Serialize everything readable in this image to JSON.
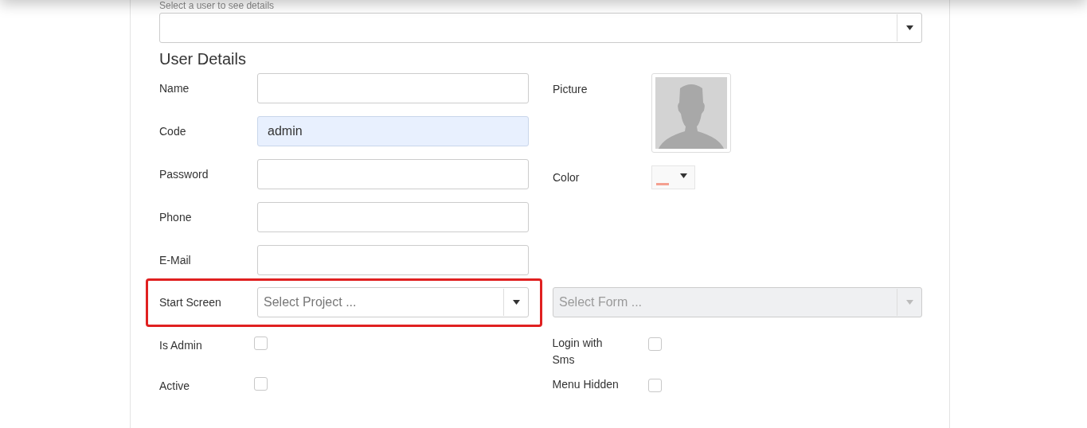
{
  "user_select": {
    "label": "Select a user to see details"
  },
  "heading": "User Details",
  "fields": [
    {
      "label": "Name",
      "autofilled": false
    },
    {
      "label": "Code",
      "value": "admin",
      "autofilled": true
    },
    {
      "label": "Password",
      "autofilled": false
    },
    {
      "label": "Phone",
      "autofilled": false
    },
    {
      "label": "E-Mail",
      "autofilled": false
    }
  ],
  "picture": {
    "label": "Picture"
  },
  "color_picker": {
    "label": "Color",
    "color": "#f4a090"
  },
  "start_screen": {
    "label": "Start Screen",
    "project_placeholder": "Select Project ...",
    "form_placeholder": "Select Form ...",
    "form_disabled": true,
    "highlighted": true
  },
  "checkboxes_left": [
    {
      "label": "Is Admin",
      "checked": false
    },
    {
      "label": "Active",
      "checked": false
    }
  ],
  "checkboxes_right": [
    {
      "label": "Login with Sms",
      "checked": false
    },
    {
      "label": "Menu Hidden",
      "checked": false
    }
  ]
}
